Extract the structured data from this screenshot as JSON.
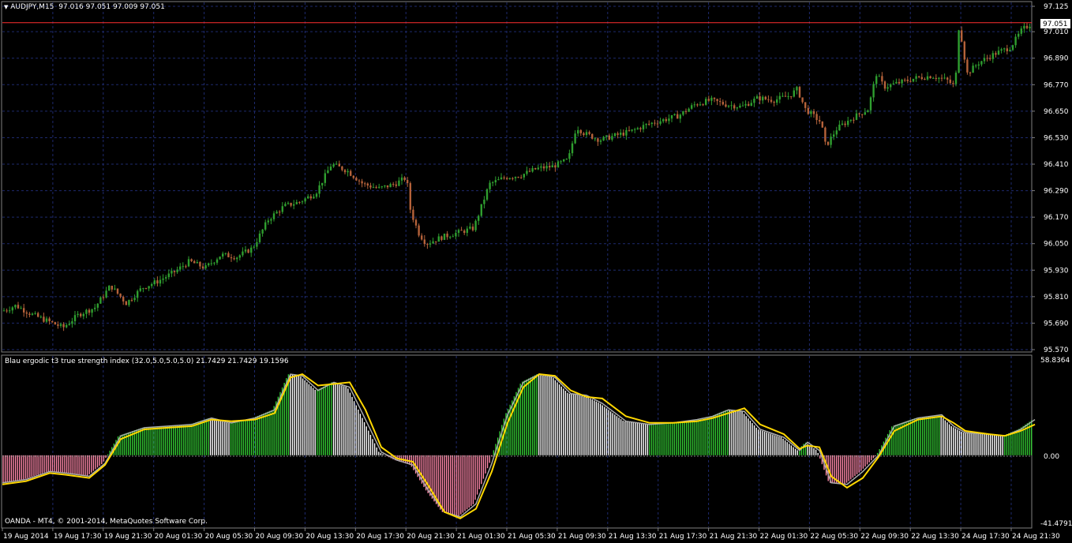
{
  "header": {
    "symbol_label": "AUDJPY,M15",
    "ohlc_label": "97.016 97.051 97.009 97.051"
  },
  "price_axis": {
    "ticks": [
      "97.125",
      "97.010",
      "96.890",
      "96.770",
      "96.650",
      "96.530",
      "96.410",
      "96.290",
      "96.170",
      "96.050",
      "95.930",
      "95.810",
      "95.690",
      "95.570"
    ],
    "current_price": "97.051"
  },
  "indicator": {
    "title": "Blau ergodic t3 true strength index (32.0,5.0,5.0,5.0) 21.7429 21.7429 19.1596",
    "max_label": "58.8364",
    "zero_label": "0.00",
    "min_label": "-41.4791"
  },
  "footer": {
    "copyright": "OANDA - MT4, © 2001-2014, MetaQuotes Software Corp."
  },
  "time_axis": {
    "labels": [
      "19 Aug 2014",
      "19 Aug 17:30",
      "19 Aug 21:30",
      "20 Aug 01:30",
      "20 Aug 05:30",
      "20 Aug 09:30",
      "20 Aug 13:30",
      "20 Aug 17:30",
      "20 Aug 21:30",
      "21 Aug 01:30",
      "21 Aug 05:30",
      "21 Aug 09:30",
      "21 Aug 13:30",
      "21 Aug 17:30",
      "21 Aug 21:30",
      "22 Aug 01:30",
      "22 Aug 05:30",
      "22 Aug 09:30",
      "22 Aug 13:30",
      "24 Aug 17:30",
      "24 Aug 21:30"
    ]
  },
  "colors": {
    "background": "#000000",
    "grid": "#1e2a6e",
    "bull_candle": "#2f9e2f",
    "bear_candle": "#b5623a",
    "histogram_positive": "#33cc33",
    "histogram_positive_weak": "#ffffff",
    "histogram_negative": "#ff88aa",
    "signal_line": "#ffd700",
    "tsi_line": "#aaaaaa",
    "price_line": "#ff3030",
    "frame": "#808080"
  },
  "chart_data": {
    "type": "line",
    "price": {
      "ylim": [
        95.57,
        97.125
      ],
      "path": [
        [
          0,
          95.74
        ],
        [
          20,
          95.77
        ],
        [
          40,
          95.73
        ],
        [
          60,
          95.7
        ],
        [
          80,
          95.67
        ],
        [
          100,
          95.73
        ],
        [
          120,
          95.76
        ],
        [
          140,
          95.86
        ],
        [
          160,
          95.78
        ],
        [
          180,
          95.85
        ],
        [
          200,
          95.88
        ],
        [
          220,
          95.92
        ],
        [
          240,
          95.97
        ],
        [
          260,
          95.94
        ],
        [
          280,
          96.0
        ],
        [
          300,
          95.99
        ],
        [
          320,
          96.03
        ],
        [
          340,
          96.16
        ],
        [
          360,
          96.22
        ],
        [
          380,
          96.24
        ],
        [
          400,
          96.28
        ],
        [
          420,
          96.41
        ],
        [
          440,
          96.38
        ],
        [
          460,
          96.32
        ],
        [
          480,
          96.3
        ],
        [
          500,
          96.32
        ],
        [
          515,
          96.35
        ],
        [
          520,
          96.2
        ],
        [
          530,
          96.1
        ],
        [
          540,
          96.05
        ],
        [
          560,
          96.08
        ],
        [
          580,
          96.1
        ],
        [
          600,
          96.12
        ],
        [
          620,
          96.32
        ],
        [
          640,
          96.35
        ],
        [
          660,
          96.36
        ],
        [
          680,
          96.39
        ],
        [
          700,
          96.4
        ],
        [
          720,
          96.43
        ],
        [
          730,
          96.58
        ],
        [
          740,
          96.55
        ],
        [
          760,
          96.52
        ],
        [
          780,
          96.54
        ],
        [
          800,
          96.56
        ],
        [
          820,
          96.59
        ],
        [
          840,
          96.61
        ],
        [
          860,
          96.63
        ],
        [
          880,
          96.68
        ],
        [
          900,
          96.7
        ],
        [
          920,
          96.68
        ],
        [
          940,
          96.67
        ],
        [
          960,
          96.71
        ],
        [
          980,
          96.7
        ],
        [
          1000,
          96.72
        ],
        [
          1010,
          96.75
        ],
        [
          1020,
          96.66
        ],
        [
          1040,
          96.6
        ],
        [
          1046,
          96.49
        ],
        [
          1060,
          96.57
        ],
        [
          1080,
          96.62
        ],
        [
          1100,
          96.66
        ],
        [
          1110,
          96.82
        ],
        [
          1120,
          96.76
        ],
        [
          1140,
          96.78
        ],
        [
          1160,
          96.8
        ],
        [
          1180,
          96.81
        ],
        [
          1200,
          96.79
        ],
        [
          1210,
          96.76
        ],
        [
          1215,
          97.05
        ],
        [
          1225,
          96.82
        ],
        [
          1240,
          96.87
        ],
        [
          1260,
          96.91
        ],
        [
          1280,
          96.94
        ],
        [
          1295,
          97.02
        ],
        [
          1308,
          97.05
        ]
      ]
    },
    "indicator": {
      "ylim": [
        -41.4791,
        58.8364
      ],
      "tsi": [
        [
          0,
          -17
        ],
        [
          30,
          -15
        ],
        [
          60,
          -10
        ],
        [
          80,
          -11
        ],
        [
          110,
          -13
        ],
        [
          130,
          -5
        ],
        [
          150,
          12
        ],
        [
          180,
          17
        ],
        [
          210,
          18
        ],
        [
          240,
          19
        ],
        [
          265,
          23
        ],
        [
          290,
          20
        ],
        [
          320,
          23
        ],
        [
          345,
          28
        ],
        [
          365,
          50
        ],
        [
          380,
          49
        ],
        [
          400,
          40
        ],
        [
          420,
          45
        ],
        [
          440,
          42
        ],
        [
          460,
          22
        ],
        [
          480,
          2
        ],
        [
          500,
          -3
        ],
        [
          520,
          -6
        ],
        [
          540,
          -22
        ],
        [
          560,
          -35
        ],
        [
          580,
          -38
        ],
        [
          600,
          -30
        ],
        [
          620,
          -5
        ],
        [
          640,
          25
        ],
        [
          660,
          45
        ],
        [
          680,
          50
        ],
        [
          700,
          48
        ],
        [
          720,
          38
        ],
        [
          740,
          37
        ],
        [
          760,
          32
        ],
        [
          790,
          21
        ],
        [
          820,
          19
        ],
        [
          850,
          20
        ],
        [
          880,
          22
        ],
        [
          900,
          24
        ],
        [
          920,
          28
        ],
        [
          940,
          27
        ],
        [
          960,
          16
        ],
        [
          990,
          11
        ],
        [
          1010,
          3
        ],
        [
          1020,
          8
        ],
        [
          1035,
          3
        ],
        [
          1050,
          -17
        ],
        [
          1070,
          -18
        ],
        [
          1090,
          -10
        ],
        [
          1110,
          0
        ],
        [
          1130,
          18
        ],
        [
          1160,
          23
        ],
        [
          1190,
          25
        ],
        [
          1205,
          18
        ],
        [
          1220,
          14
        ],
        [
          1250,
          13
        ],
        [
          1270,
          12
        ],
        [
          1290,
          16
        ],
        [
          1308,
          22
        ]
      ],
      "signal": [
        [
          0,
          -18
        ],
        [
          30,
          -16
        ],
        [
          60,
          -11
        ],
        [
          80,
          -12
        ],
        [
          110,
          -14
        ],
        [
          130,
          -6
        ],
        [
          150,
          10
        ],
        [
          180,
          16
        ],
        [
          210,
          17
        ],
        [
          240,
          18
        ],
        [
          265,
          22
        ],
        [
          290,
          21
        ],
        [
          320,
          22
        ],
        [
          345,
          26
        ],
        [
          365,
          48
        ],
        [
          380,
          50
        ],
        [
          400,
          43
        ],
        [
          420,
          44
        ],
        [
          440,
          45
        ],
        [
          460,
          28
        ],
        [
          480,
          5
        ],
        [
          500,
          -2
        ],
        [
          520,
          -4
        ],
        [
          540,
          -19
        ],
        [
          560,
          -35
        ],
        [
          580,
          -39
        ],
        [
          600,
          -33
        ],
        [
          620,
          -10
        ],
        [
          640,
          20
        ],
        [
          660,
          42
        ],
        [
          680,
          50
        ],
        [
          700,
          49
        ],
        [
          720,
          40
        ],
        [
          740,
          36
        ],
        [
          760,
          35
        ],
        [
          790,
          24
        ],
        [
          820,
          20
        ],
        [
          850,
          20
        ],
        [
          880,
          21
        ],
        [
          900,
          23
        ],
        [
          920,
          26
        ],
        [
          940,
          29
        ],
        [
          960,
          19
        ],
        [
          990,
          13
        ],
        [
          1010,
          4
        ],
        [
          1020,
          6
        ],
        [
          1035,
          5
        ],
        [
          1050,
          -13
        ],
        [
          1070,
          -20
        ],
        [
          1090,
          -14
        ],
        [
          1110,
          -1
        ],
        [
          1130,
          15
        ],
        [
          1160,
          22
        ],
        [
          1190,
          24
        ],
        [
          1205,
          20
        ],
        [
          1220,
          15
        ],
        [
          1250,
          13
        ],
        [
          1270,
          12
        ],
        [
          1290,
          15
        ],
        [
          1308,
          19
        ]
      ]
    }
  }
}
